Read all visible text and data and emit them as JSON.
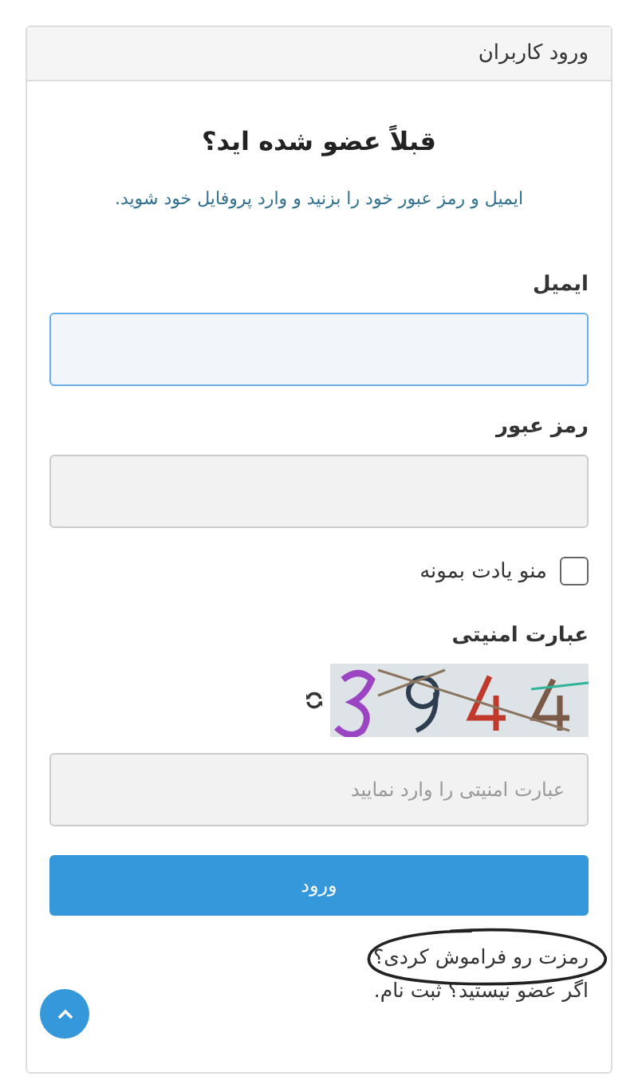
{
  "panel": {
    "title": "ورود کاربران"
  },
  "heading": "قبلاً عضو شده اید؟",
  "intro": "ایمیل و رمز عبور خود را بزنید و وارد پروفایل خود شوید.",
  "fields": [
    {
      "label": "ایمیل",
      "focused": true
    },
    {
      "label": "رمز عبور",
      "focused": false
    }
  ],
  "remember": {
    "label": "منو یادت بمونه",
    "checked": false
  },
  "captcha": {
    "label": "عبارت امنیتی",
    "placeholder": "عبارت امنیتی را وارد نمایید"
  },
  "submit": "ورود",
  "forgot_link": {
    "text": "رمزت رو فراموش کردی؟",
    "circled": true
  },
  "register_text": "اگر عضو نیستید؟ ثبت نام.",
  "scroll_top": true
}
